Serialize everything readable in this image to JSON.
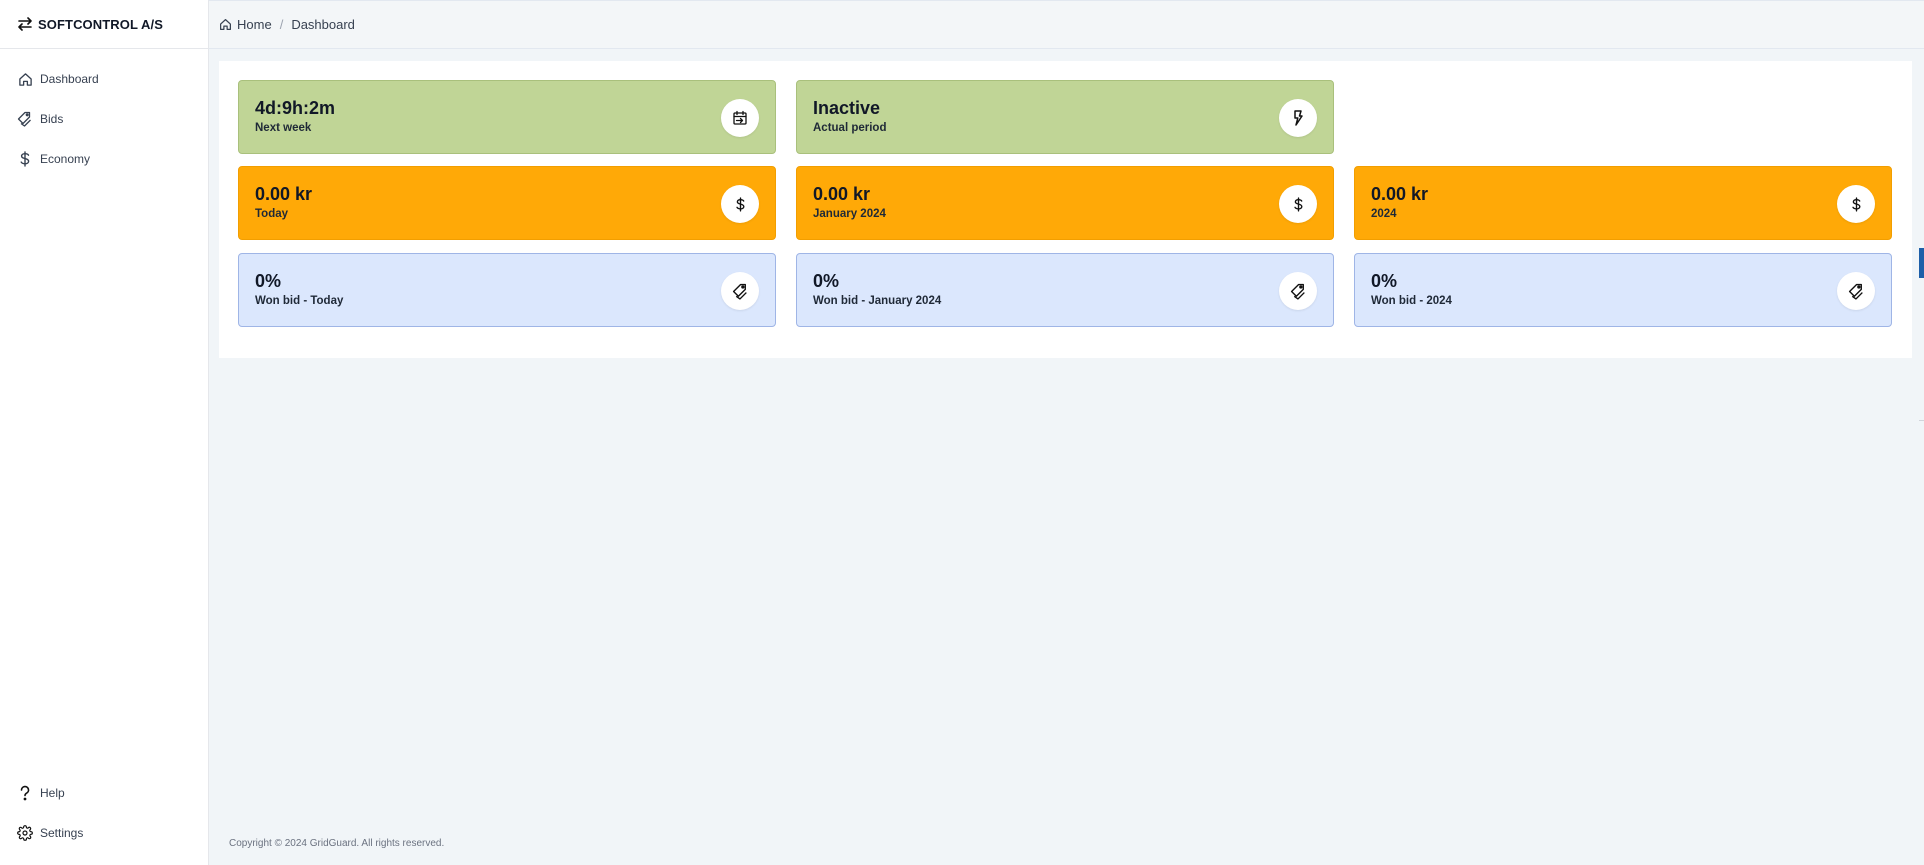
{
  "brand": {
    "name": "SOFTCONTROL A/S",
    "icon": "swap-arrows-icon"
  },
  "sidebar": {
    "items": [
      {
        "label": "Dashboard",
        "icon": "home-icon"
      },
      {
        "label": "Bids",
        "icon": "tag-icon"
      },
      {
        "label": "Economy",
        "icon": "dollar-icon"
      }
    ],
    "bottom_items": [
      {
        "label": "Help",
        "icon": "question-icon"
      },
      {
        "label": "Settings",
        "icon": "gear-icon"
      }
    ]
  },
  "breadcrumb": {
    "home": "Home",
    "separator": "/",
    "current": "Dashboard"
  },
  "cards": {
    "next_week": {
      "value": "4d:9h:2m",
      "label": "Next week",
      "icon": "calendar-arrow-icon"
    },
    "actual_period": {
      "value": "Inactive",
      "label": "Actual period",
      "icon": "lightning-icon"
    },
    "revenue_today": {
      "value": "0.00 kr",
      "label": "Today",
      "icon": "dollar-icon"
    },
    "revenue_month": {
      "value": "0.00 kr",
      "label": "January 2024",
      "icon": "dollar-icon"
    },
    "revenue_year": {
      "value": "0.00 kr",
      "label": "2024",
      "icon": "dollar-icon"
    },
    "won_today": {
      "value": "0%",
      "label": "Won bid - Today",
      "icon": "tag-icon"
    },
    "won_month": {
      "value": "0%",
      "label": "Won bid - January 2024",
      "icon": "tag-icon"
    },
    "won_year": {
      "value": "0%",
      "label": "Won bid - 2024",
      "icon": "tag-icon"
    }
  },
  "colors": {
    "green": "#c0d596",
    "orange": "#ffa907",
    "blue": "#dbe7fd"
  },
  "footer": "Copyright © 2024 GridGuard. All rights reserved."
}
